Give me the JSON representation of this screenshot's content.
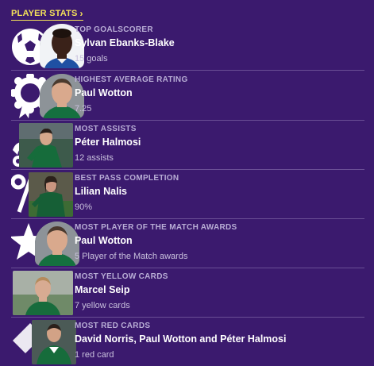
{
  "panel": {
    "title": "PLAYER STATS",
    "chevron_icon": "chevron-right-icon"
  },
  "stats": [
    {
      "label": "TOP GOALSCORER",
      "name": "Sylvan Ebanks-Blake",
      "value": "15 goals",
      "icon": "football-icon"
    },
    {
      "label": "HIGHEST AVERAGE RATING",
      "name": "Paul Wotton",
      "value": "7.25",
      "icon": "rosette-icon"
    },
    {
      "label": "MOST ASSISTS",
      "name": "Péter Halmosi",
      "value": "12 assists",
      "icon": "assist-icon"
    },
    {
      "label": "BEST PASS COMPLETION",
      "name": "Lilian Nalis",
      "value": "90%",
      "icon": "percent-icon"
    },
    {
      "label": "MOST PLAYER OF THE MATCH AWARDS",
      "name": "Paul Wotton",
      "value": "5 Player of the Match awards",
      "icon": "star-icon"
    },
    {
      "label": "MOST YELLOW CARDS",
      "name": "Marcel Seip",
      "value": "7 yellow cards",
      "icon": "yellow-card-icon"
    },
    {
      "label": "MOST RED CARDS",
      "name": "David Norris, Paul Wotton and Péter Halmosi",
      "value": "1 red card",
      "icon": "red-card-icon"
    }
  ],
  "colors": {
    "background": "#3b1a6e",
    "header": "#f3e15a",
    "label": "#b9aed6",
    "value": "#c9c1dd",
    "divider": "#6a4f95"
  }
}
